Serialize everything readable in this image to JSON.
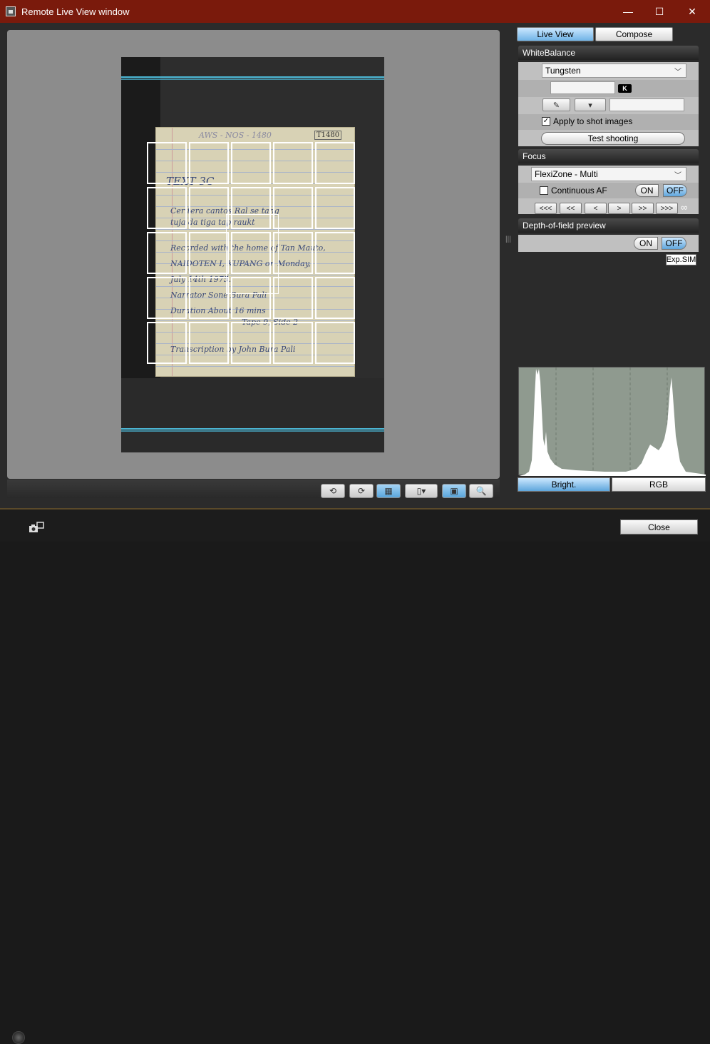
{
  "window": {
    "title": "Remote Live View window",
    "controls": {
      "minimize": "—",
      "maximize": "☐",
      "close": "✕"
    }
  },
  "tabs": {
    "live_view": "Live View",
    "compose": "Compose"
  },
  "white_balance": {
    "heading": "WhiteBalance",
    "selected": "Tungsten",
    "kelvin_badge": "K",
    "apply_label": "Apply to shot images",
    "apply_checked": true,
    "test_shooting": "Test shooting"
  },
  "focus": {
    "heading": "Focus",
    "mode": "FlexiZone - Multi",
    "continuous_af_label": "Continuous AF",
    "continuous_af_checked": false,
    "on_label": "ON",
    "off_label": "OFF",
    "nav_buttons": [
      "<<<",
      "<<",
      "<",
      ">",
      ">>",
      ">>>"
    ],
    "infinity": "∞"
  },
  "dof": {
    "heading": "Depth-of-field preview",
    "on_label": "ON",
    "off_label": "OFF",
    "exp_sim": "Exp.SIM"
  },
  "histogram": {
    "bright_label": "Bright.",
    "rgb_label": "RGB",
    "bg_color": "#8f9a8f"
  },
  "footer": {
    "close_label": "Close"
  },
  "document": {
    "tag": "T1480",
    "header_note": "AWS - NOS - 1480",
    "lines": [
      "TEXT 3C",
      "Ceritera   cantos   Ral   se   tang",
      "tuja   da   tiga    tap   raukt",
      "Recorded   with   the   home   of   Tan   Mauto,",
      "NAIDOTEN   I,   KUPANG    on  Monday,",
      "July   14th   1975.",
      "Narrator   Sone   Bura   Pali",
      "Duration    About   16   mins",
      "Tape   9,   Side 2",
      "Transcription   by   John   Bura   Pali"
    ]
  },
  "accent_color": "#5fa6dc",
  "titlebar_color": "#7a1a0c"
}
